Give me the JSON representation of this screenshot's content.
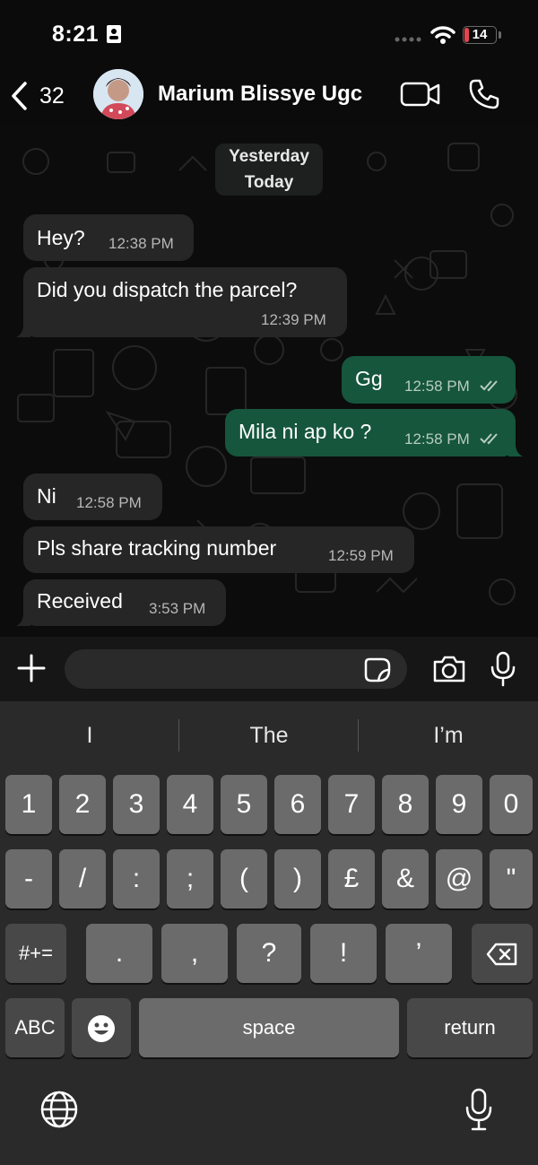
{
  "status_bar": {
    "time": "8:21",
    "battery_level": "14",
    "battery_color": "#e5454d"
  },
  "header": {
    "back_count": "32",
    "contact_name": "Marium Blissye Ugc",
    "icons": [
      "chevron-left-icon",
      "video-camera-icon",
      "phone-icon"
    ]
  },
  "chat": {
    "date_chip": [
      "Yesterday",
      "Today"
    ],
    "messages": [
      {
        "direction": "in",
        "text": "Hey?",
        "time": "12:38 PM"
      },
      {
        "direction": "in",
        "text": "Did you dispatch the parcel?",
        "time": "12:39 PM"
      },
      {
        "direction": "out",
        "text": "Gg",
        "time": "12:58 PM",
        "status": "read"
      },
      {
        "direction": "out",
        "text": "Mila ni ap ko ?",
        "time": "12:58 PM",
        "status": "read"
      },
      {
        "direction": "in",
        "text": "Ni",
        "time": "12:58 PM"
      },
      {
        "direction": "in",
        "text": "Pls share tracking number",
        "time": "12:59 PM"
      },
      {
        "direction": "in",
        "text": "Received",
        "time": "3:53 PM"
      }
    ],
    "outgoing_color": "#15563c",
    "incoming_color": "#262626"
  },
  "input_bar": {
    "value": "",
    "icons": [
      "plus-icon",
      "sticker-icon",
      "camera-icon",
      "microphone-icon"
    ]
  },
  "keyboard": {
    "suggestions": [
      "I",
      "The",
      "I’m"
    ],
    "row1": [
      "1",
      "2",
      "3",
      "4",
      "5",
      "6",
      "7",
      "8",
      "9",
      "0"
    ],
    "row2": [
      "-",
      "/",
      ":",
      ";",
      "(",
      ")",
      "£",
      "&",
      "@",
      "\""
    ],
    "row3_toggle": "#+=",
    "row3": [
      ".",
      ",",
      "?",
      "!",
      "’"
    ],
    "abc_label": "ABC",
    "space_label": "space",
    "return_label": "return"
  }
}
